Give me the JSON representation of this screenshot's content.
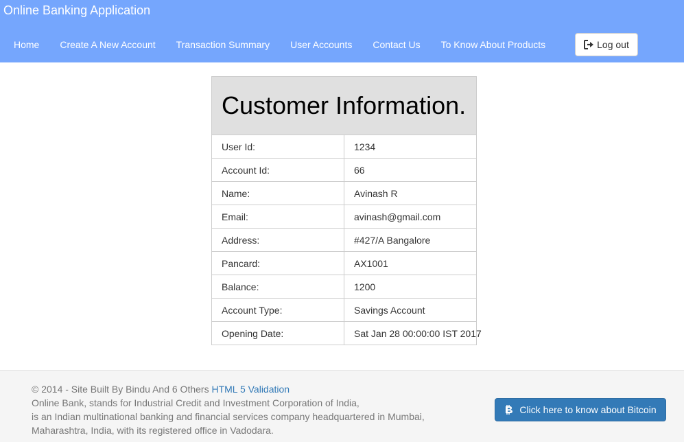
{
  "navbar": {
    "brand": "Online Banking Application",
    "links": [
      "Home",
      "Create A New Account",
      "Transaction Summary",
      "User Accounts",
      "Contact Us",
      "To Know About Products"
    ],
    "logout_label": "Log out",
    "logout_icon": "logout-icon"
  },
  "customer": {
    "title": "Customer Information.",
    "rows": [
      {
        "label": "User Id:",
        "value": "1234"
      },
      {
        "label": "Account Id:",
        "value": "66"
      },
      {
        "label": "Name:",
        "value": "Avinash R"
      },
      {
        "label": "Email:",
        "value": "avinash@gmail.com"
      },
      {
        "label": "Address:",
        "value": "#427/A Bangalore"
      },
      {
        "label": "Pancard:",
        "value": "AX1001"
      },
      {
        "label": "Balance:",
        "value": "1200"
      },
      {
        "label": "Account Type:",
        "value": "Savings Account"
      },
      {
        "label": "Opening Date:",
        "value": "Sat Jan 28 00:00:00 IST 2017"
      }
    ]
  },
  "footer": {
    "copyright": "© 2014 - Site Built By Bindu And 6 Others ",
    "validation_link": "HTML 5 Validation",
    "lines": [
      "Online Bank, stands for Industrial Credit and Investment Corporation of India,",
      "is an Indian multinational banking and financial services company headquartered in Mumbai,",
      "Maharashtra, India, with its registered office in Vadodara."
    ],
    "bitcoin_button": "Click here to know about Bitcoin",
    "bitcoin_icon": "bitcoin-icon"
  },
  "colors": {
    "navbar": "#75a6fd",
    "header_cell": "#e0e0e0",
    "primary_button": "#337ab7",
    "footer_bg": "#f5f5f5"
  }
}
